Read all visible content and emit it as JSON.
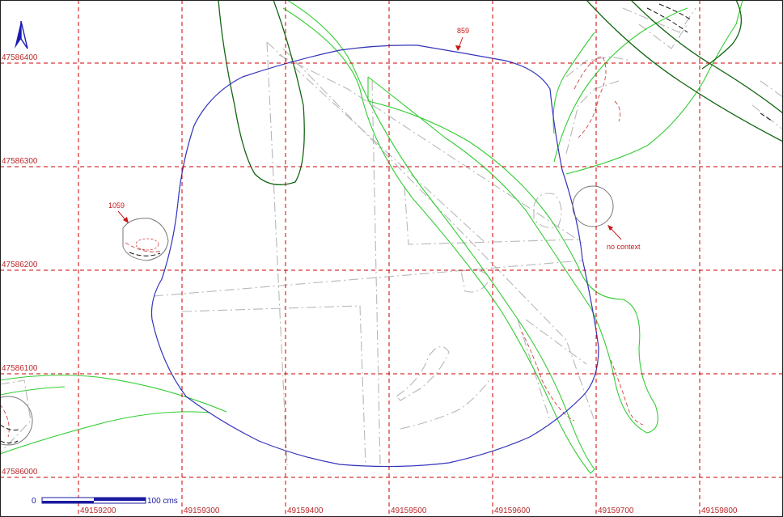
{
  "map": {
    "grid": {
      "x_labels": [
        "49159200",
        "49159300",
        "49159400",
        "49159500",
        "49159600",
        "49159700",
        "49159800"
      ],
      "y_labels": [
        "47586400",
        "47586300",
        "47586200",
        "47586100",
        "47586000"
      ]
    },
    "annotations": {
      "feature_859": "859",
      "feature_1059": "1059",
      "no_context": "no context"
    },
    "scale_bar": {
      "start_label": "0",
      "end_label": "100 cms"
    },
    "colors": {
      "grid": "#cc0000",
      "outline_blue": "#3333bb",
      "green_light": "#33cc33",
      "green_dark": "#116611",
      "grey": "#b8b8b8",
      "north_arrow": "#1a1ab0"
    },
    "icons": {
      "north_arrow": "north-arrow-icon"
    }
  }
}
